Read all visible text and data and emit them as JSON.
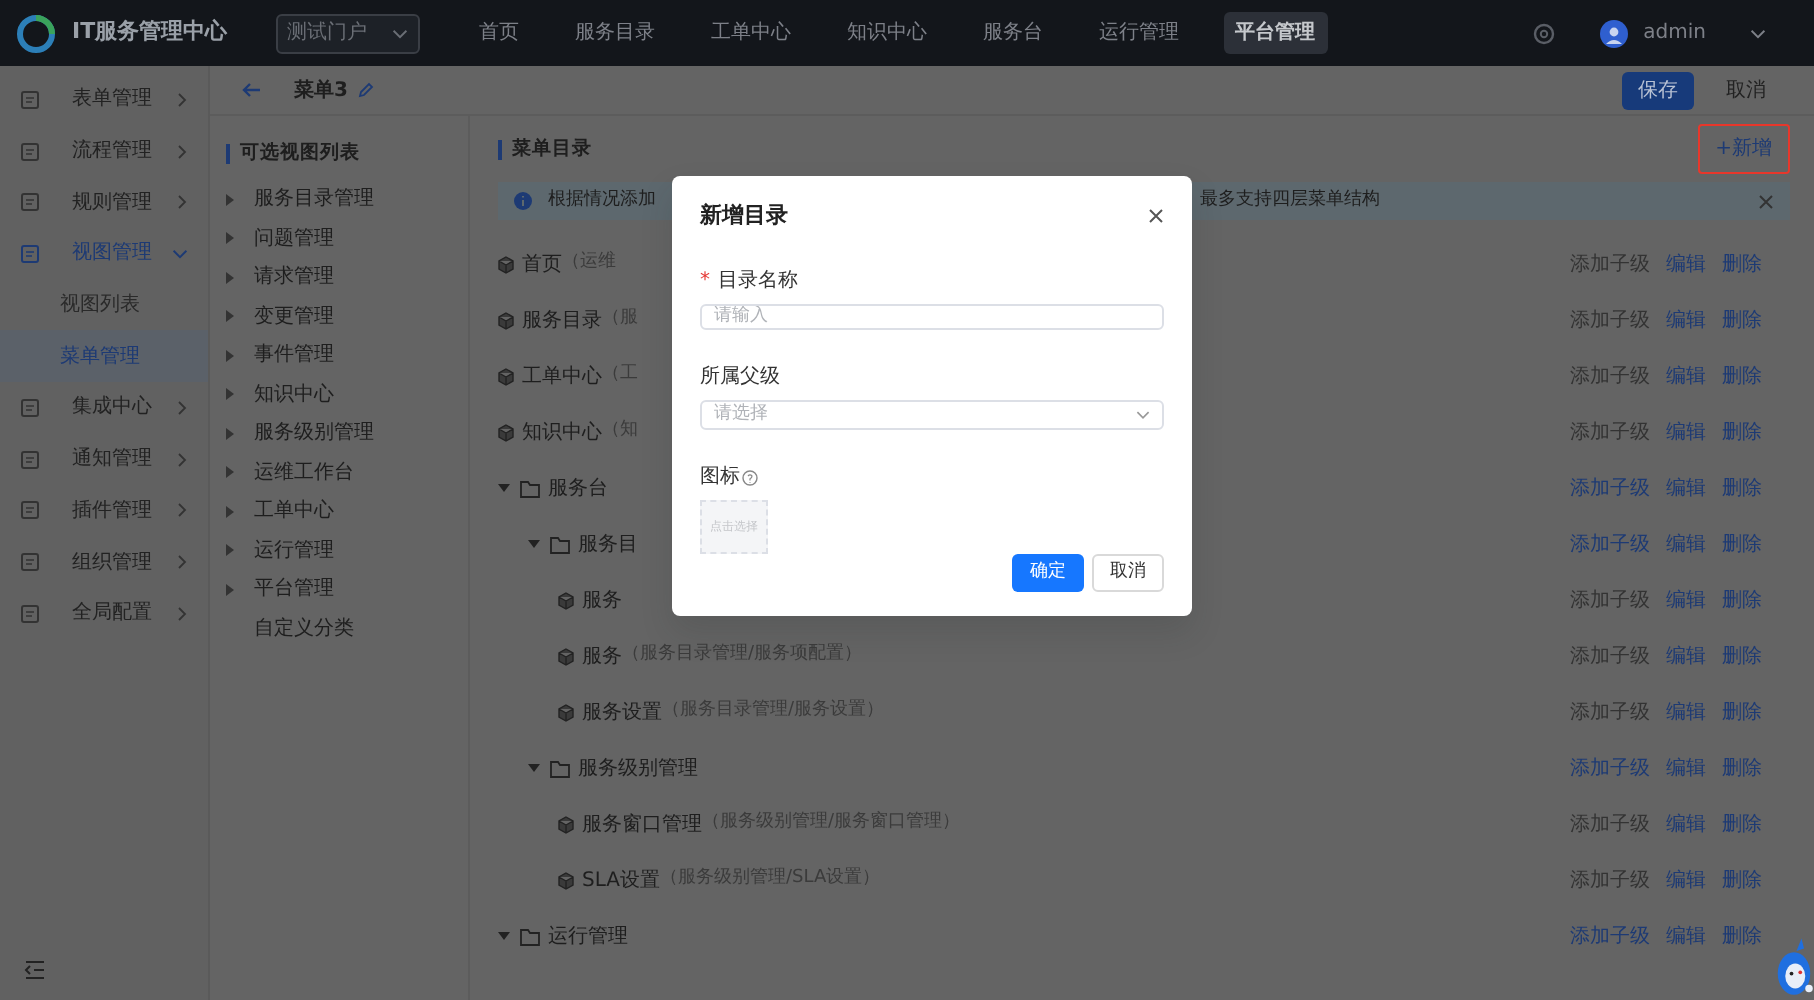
{
  "header": {
    "app_title": "IT服务管理中心",
    "portal_select": {
      "value": "测试门户"
    },
    "nav": [
      {
        "label": "首页",
        "selected": false
      },
      {
        "label": "服务目录",
        "selected": false
      },
      {
        "label": "工单中心",
        "selected": false
      },
      {
        "label": "知识中心",
        "selected": false
      },
      {
        "label": "服务台",
        "selected": false
      },
      {
        "label": "运行管理",
        "selected": false
      },
      {
        "label": "平台管理",
        "selected": true
      }
    ],
    "user": {
      "name": "admin"
    }
  },
  "sidebar": {
    "items": [
      {
        "label": "表单管理",
        "expanded": false
      },
      {
        "label": "流程管理",
        "expanded": false
      },
      {
        "label": "规则管理",
        "expanded": false
      },
      {
        "label": "视图管理",
        "expanded": true,
        "children": [
          {
            "label": "视图列表",
            "selected": false
          },
          {
            "label": "菜单管理",
            "selected": true
          }
        ]
      },
      {
        "label": "集成中心",
        "expanded": false
      },
      {
        "label": "通知管理",
        "expanded": false
      },
      {
        "label": "插件管理",
        "expanded": false
      },
      {
        "label": "组织管理",
        "expanded": false
      },
      {
        "label": "全局配置",
        "expanded": false
      }
    ]
  },
  "editor": {
    "title": "菜单3",
    "save_label": "保存",
    "cancel_label": "取消"
  },
  "view_list": {
    "title": "可选视图列表",
    "items": [
      {
        "label": "服务目录管理",
        "has_children": true
      },
      {
        "label": "问题管理",
        "has_children": true
      },
      {
        "label": "请求管理",
        "has_children": true
      },
      {
        "label": "变更管理",
        "has_children": true
      },
      {
        "label": "事件管理",
        "has_children": true
      },
      {
        "label": "知识中心",
        "has_children": true
      },
      {
        "label": "服务级别管理",
        "has_children": true
      },
      {
        "label": "运维工作台",
        "has_children": true
      },
      {
        "label": "工单中心",
        "has_children": true
      },
      {
        "label": "运行管理",
        "has_children": true
      },
      {
        "label": "平台管理",
        "has_children": true
      },
      {
        "label": "自定义分类",
        "has_children": false
      }
    ]
  },
  "menu_tree": {
    "title": "菜单目录",
    "add_label": "+新增",
    "notice": {
      "text_start": "根据情况添加",
      "text_end": "最多支持四层菜单结构"
    },
    "rows": [
      {
        "kind": "page",
        "label": "首页",
        "path": "（运维",
        "actions": [
          {
            "label": "添加子级",
            "disabled": true
          },
          {
            "label": "编辑",
            "disabled": false
          },
          {
            "label": "删除",
            "disabled": false
          }
        ]
      },
      {
        "kind": "page",
        "label": "服务目录",
        "path": "（服",
        "actions": [
          {
            "label": "添加子级",
            "disabled": true
          },
          {
            "label": "编辑",
            "disabled": false
          },
          {
            "label": "删除",
            "disabled": false
          }
        ]
      },
      {
        "kind": "page",
        "label": "工单中心",
        "path": "（工",
        "actions": [
          {
            "label": "添加子级",
            "disabled": true
          },
          {
            "label": "编辑",
            "disabled": false
          },
          {
            "label": "删除",
            "disabled": false
          }
        ]
      },
      {
        "kind": "page",
        "label": "知识中心",
        "path": "（知",
        "actions": [
          {
            "label": "添加子级",
            "disabled": true
          },
          {
            "label": "编辑",
            "disabled": false
          },
          {
            "label": "删除",
            "disabled": false
          }
        ]
      },
      {
        "kind": "folder",
        "label": "服务台",
        "expanded": true,
        "actions": [
          {
            "label": "添加子级",
            "disabled": false
          },
          {
            "label": "编辑",
            "disabled": false
          },
          {
            "label": "删除",
            "disabled": false
          }
        ],
        "children": [
          {
            "kind": "folder",
            "label": "服务目",
            "expanded": true,
            "actions": [
              {
                "label": "添加子级",
                "disabled": false
              },
              {
                "label": "编辑",
                "disabled": false
              },
              {
                "label": "删除",
                "disabled": false
              }
            ],
            "children": [
              {
                "kind": "page",
                "label": "服务",
                "actions": [
                  {
                    "label": "添加子级",
                    "disabled": true
                  },
                  {
                    "label": "编辑",
                    "disabled": false
                  },
                  {
                    "label": "删除",
                    "disabled": false
                  }
                ]
              },
              {
                "kind": "page",
                "label": "服务",
                "path": "（服务目录管理/服务项配置）",
                "actions": [
                  {
                    "label": "添加子级",
                    "disabled": true
                  },
                  {
                    "label": "编辑",
                    "disabled": false
                  },
                  {
                    "label": "删除",
                    "disabled": false
                  }
                ]
              },
              {
                "kind": "page",
                "label": "服务设置",
                "path": "（服务目录管理/服务设置）",
                "actions": [
                  {
                    "label": "添加子级",
                    "disabled": true
                  },
                  {
                    "label": "编辑",
                    "disabled": false
                  },
                  {
                    "label": "删除",
                    "disabled": false
                  }
                ]
              }
            ]
          },
          {
            "kind": "folder",
            "label": "服务级别管理",
            "expanded": true,
            "actions": [
              {
                "label": "添加子级",
                "disabled": false
              },
              {
                "label": "编辑",
                "disabled": false
              },
              {
                "label": "删除",
                "disabled": false
              }
            ],
            "children": [
              {
                "kind": "page",
                "label": "服务窗口管理",
                "path": "（服务级别管理/服务窗口管理）",
                "actions": [
                  {
                    "label": "添加子级",
                    "disabled": true
                  },
                  {
                    "label": "编辑",
                    "disabled": false
                  },
                  {
                    "label": "删除",
                    "disabled": false
                  }
                ]
              },
              {
                "kind": "page",
                "label": "SLA设置",
                "path": "（服务级别管理/SLA设置）",
                "actions": [
                  {
                    "label": "添加子级",
                    "disabled": true
                  },
                  {
                    "label": "编辑",
                    "disabled": false
                  },
                  {
                    "label": "删除",
                    "disabled": false
                  }
                ]
              }
            ]
          }
        ]
      },
      {
        "kind": "folder",
        "label": "运行管理",
        "expanded": true,
        "actions": [
          {
            "label": "添加子级",
            "disabled": false
          },
          {
            "label": "编辑",
            "disabled": false
          },
          {
            "label": "删除",
            "disabled": false
          }
        ]
      }
    ]
  },
  "modal": {
    "title": "新增目录",
    "fields": [
      {
        "kind": "input",
        "required_mark": "*",
        "label": "目录名称",
        "placeholder": "请输入"
      },
      {
        "kind": "select",
        "label": "所属父级",
        "placeholder": "请选择"
      },
      {
        "kind": "icon_picker",
        "label": "图标",
        "placeholder": "点击选择"
      }
    ],
    "buttons": [
      {
        "label": "确定",
        "primary": true
      },
      {
        "label": "取消",
        "primary": false
      }
    ]
  }
}
